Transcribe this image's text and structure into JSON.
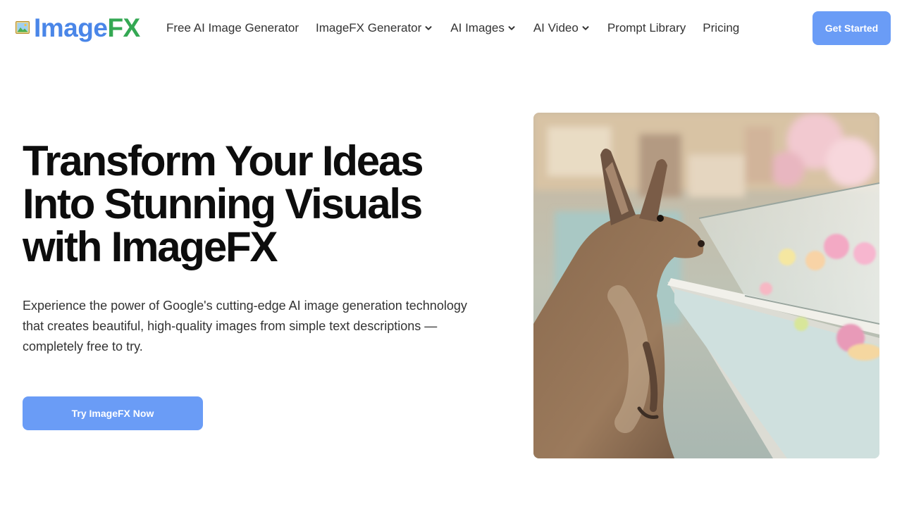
{
  "header": {
    "logo": {
      "icon": "picture-icon",
      "text_part1": "Image",
      "text_part2": "FX"
    },
    "nav": [
      {
        "label": "Free AI Image Generator",
        "dropdown": false
      },
      {
        "label": "ImageFX Generator",
        "dropdown": true
      },
      {
        "label": "AI Images",
        "dropdown": true
      },
      {
        "label": "AI Video",
        "dropdown": true
      },
      {
        "label": "Prompt Library",
        "dropdown": false
      },
      {
        "label": "Pricing",
        "dropdown": false
      }
    ],
    "cta_label": "Get Started"
  },
  "hero": {
    "title_lines": [
      "Transform Your Ideas",
      "Into Stunning Visuals",
      "with ImageFX"
    ],
    "description": "Experience the power of Google's cutting-edge AI image generation technology that creates beautiful, high-quality images from simple text descriptions — completely free to try.",
    "cta_label": "Try ImageFX Now"
  },
  "colors": {
    "brand_blue": "#4a86e8",
    "brand_green": "#34a853",
    "button_blue": "#6a9cf6"
  }
}
